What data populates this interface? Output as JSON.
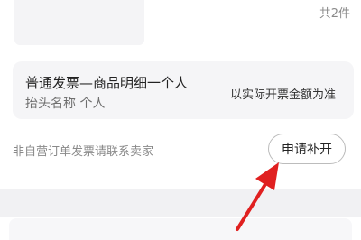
{
  "order": {
    "item_count": "共2件"
  },
  "invoice": {
    "type_label": "普通发票—商品明细一个人",
    "header_label": "抬头名称  个人",
    "amount_note": "以实际开票金额为准"
  },
  "footer": {
    "note": "非自营订单发票请联系卖家",
    "reissue_button": "申请补开"
  },
  "annotation": {
    "arrow_color": "#e02020"
  }
}
